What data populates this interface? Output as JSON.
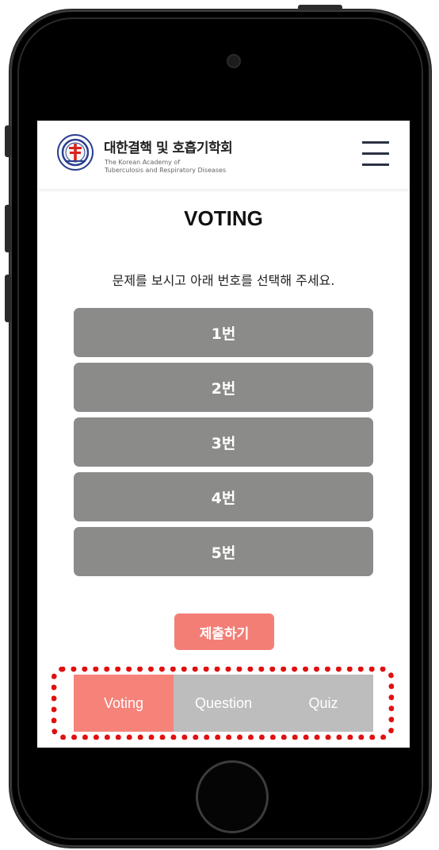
{
  "header": {
    "org_name_ko": "대한결핵 및 호흡기학회",
    "org_name_en_line1": "The Korean Academy of",
    "org_name_en_line2": "Tuberculosis and Respiratory Diseases",
    "menu_icon": "hamburger-menu-icon"
  },
  "page": {
    "title": "VOTING",
    "instruction": "문제를 보시고 아래 번호를 선택해 주세요."
  },
  "options": [
    "1번",
    "2번",
    "3번",
    "4번",
    "5번"
  ],
  "submit_label": "제출하기",
  "tabs": [
    "Voting",
    "Question",
    "Quiz"
  ],
  "active_tab": "Voting",
  "colors": {
    "option_bg": "#8b8c8a",
    "accent": "#f37e76",
    "tabbar_bg": "#bdbdbd",
    "highlight": "#e01010"
  }
}
